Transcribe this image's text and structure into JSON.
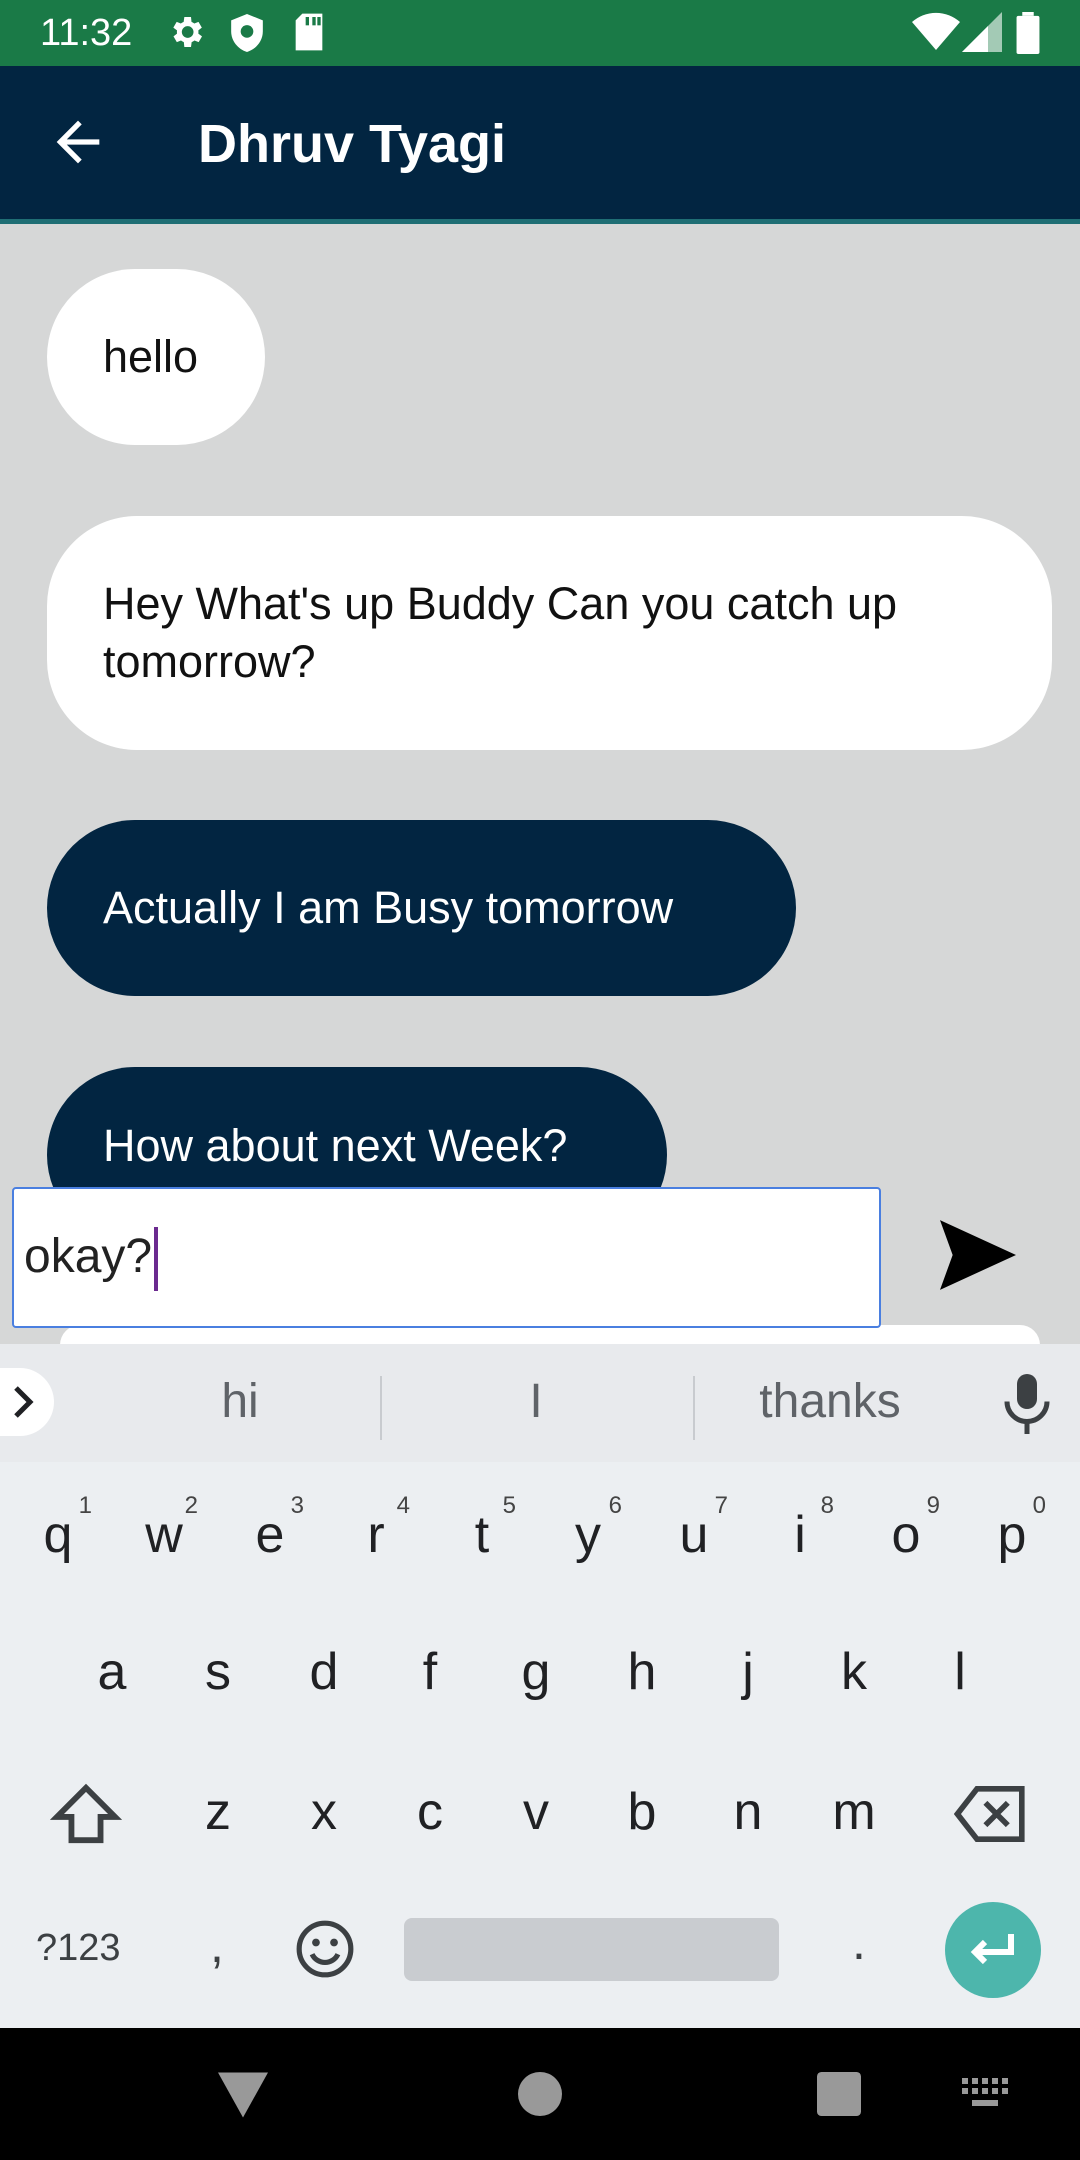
{
  "status_bar": {
    "time": "11:32",
    "icons": [
      "settings-icon",
      "shield-icon",
      "sd-card-icon",
      "wifi-icon",
      "signal-icon",
      "battery-icon"
    ]
  },
  "header": {
    "title": "Dhruv Tyagi",
    "back_icon": "arrow-back-icon"
  },
  "messages": [
    {
      "text": "hello",
      "direction": "incoming"
    },
    {
      "text": "Hey What's up Buddy Can you catch up tomorrow?",
      "direction": "incoming"
    },
    {
      "text": "Actually I am Busy tomorrow",
      "direction": "outgoing"
    },
    {
      "text": "How about next Week?",
      "direction": "outgoing"
    }
  ],
  "composer": {
    "value": "okay?",
    "send_icon": "send-icon"
  },
  "keyboard": {
    "suggestions": [
      "hi",
      "I",
      "thanks"
    ],
    "row1": [
      {
        "k": "q",
        "n": "1"
      },
      {
        "k": "w",
        "n": "2"
      },
      {
        "k": "e",
        "n": "3"
      },
      {
        "k": "r",
        "n": "4"
      },
      {
        "k": "t",
        "n": "5"
      },
      {
        "k": "y",
        "n": "6"
      },
      {
        "k": "u",
        "n": "7"
      },
      {
        "k": "i",
        "n": "8"
      },
      {
        "k": "o",
        "n": "9"
      },
      {
        "k": "p",
        "n": "0"
      }
    ],
    "row2": [
      "a",
      "s",
      "d",
      "f",
      "g",
      "h",
      "j",
      "k",
      "l"
    ],
    "row3": [
      "z",
      "x",
      "c",
      "v",
      "b",
      "n",
      "m"
    ],
    "symbols_label": "?123",
    "comma": ",",
    "period": "."
  },
  "colors": {
    "status_bar": "#1a7a47",
    "app_bar": "#022541",
    "chat_background": "#d6d7d7",
    "outgoing_bubble": "#022541",
    "incoming_bubble": "#ffffff",
    "enter_key": "#4db6ac"
  }
}
